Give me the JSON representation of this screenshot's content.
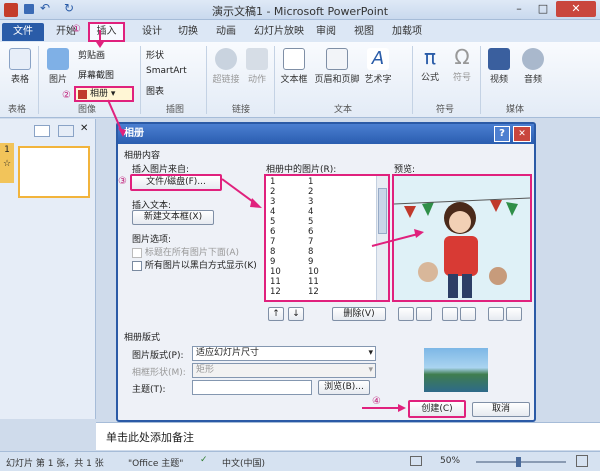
{
  "window": {
    "title": "演示文稿1 - Microsoft PowerPoint",
    "min": "–",
    "restore": "□",
    "close": "✕"
  },
  "tabs": [
    "文件",
    "开始",
    "插入",
    "设计",
    "切换",
    "动画",
    "幻灯片放映",
    "审阅",
    "视图",
    "加载项"
  ],
  "ribbon": {
    "groups": [
      "表格",
      "图像",
      "插图",
      "链接",
      "文本",
      "符号",
      "媒体"
    ],
    "items": [
      "表格",
      "图片",
      "剪贴画",
      "屏幕截图",
      "相册",
      "形状",
      "SmartArt",
      "图表",
      "超链接",
      "动作",
      "文本框",
      "页眉和页脚",
      "艺术字",
      "公式",
      "符号",
      "视频",
      "音频"
    ]
  },
  "annotations": [
    "①",
    "②",
    "③",
    "④"
  ],
  "slide_panel": {
    "number": "1",
    "marker": "☆"
  },
  "dialog": {
    "title": "相册",
    "help": "?",
    "close": "✕",
    "album_content": "相册内容",
    "insert_from": "插入图片来自:",
    "file_disk_button": "文件/磁盘(F)...",
    "insert_text": "插入文本:",
    "new_textbox_button": "新建文本框(X)",
    "picture_options": "图片选项:",
    "caption_below": "标题在所有图片下面(A)",
    "all_bw": "所有图片以黑白方式显示(K)",
    "pictures_in_album": "相册中的图片(R):",
    "picture_list": [
      "1",
      "2",
      "3",
      "4",
      "5",
      "6",
      "7",
      "8",
      "9",
      "10",
      "11",
      "12"
    ],
    "picture_names": [
      "1",
      "2",
      "3",
      "4",
      "5",
      "6",
      "7",
      "8",
      "9",
      "10",
      "11",
      "12"
    ],
    "preview": "预览:",
    "remove_button": "删除(V)",
    "album_layout": "相册版式",
    "picture_layout_label": "图片版式(P):",
    "picture_layout_value": "适应幻灯片尺寸",
    "frame_shape_label": "相框形状(M):",
    "frame_shape_value": "矩形",
    "theme_label": "主题(T):",
    "browse_button": "浏览(B)...",
    "create_button": "创建(C)",
    "cancel_button": "取消"
  },
  "notes": "单击此处添加备注",
  "status": {
    "slide": "幻灯片 第 1 张，共 1 张",
    "theme": "\"Office 主题\"",
    "lang": "中文(中国)",
    "zoom": "50%"
  },
  "colors": {
    "highlight": "#e0217d",
    "title_blue": "#2a5db0",
    "file_tab": "#2a5ca8"
  }
}
